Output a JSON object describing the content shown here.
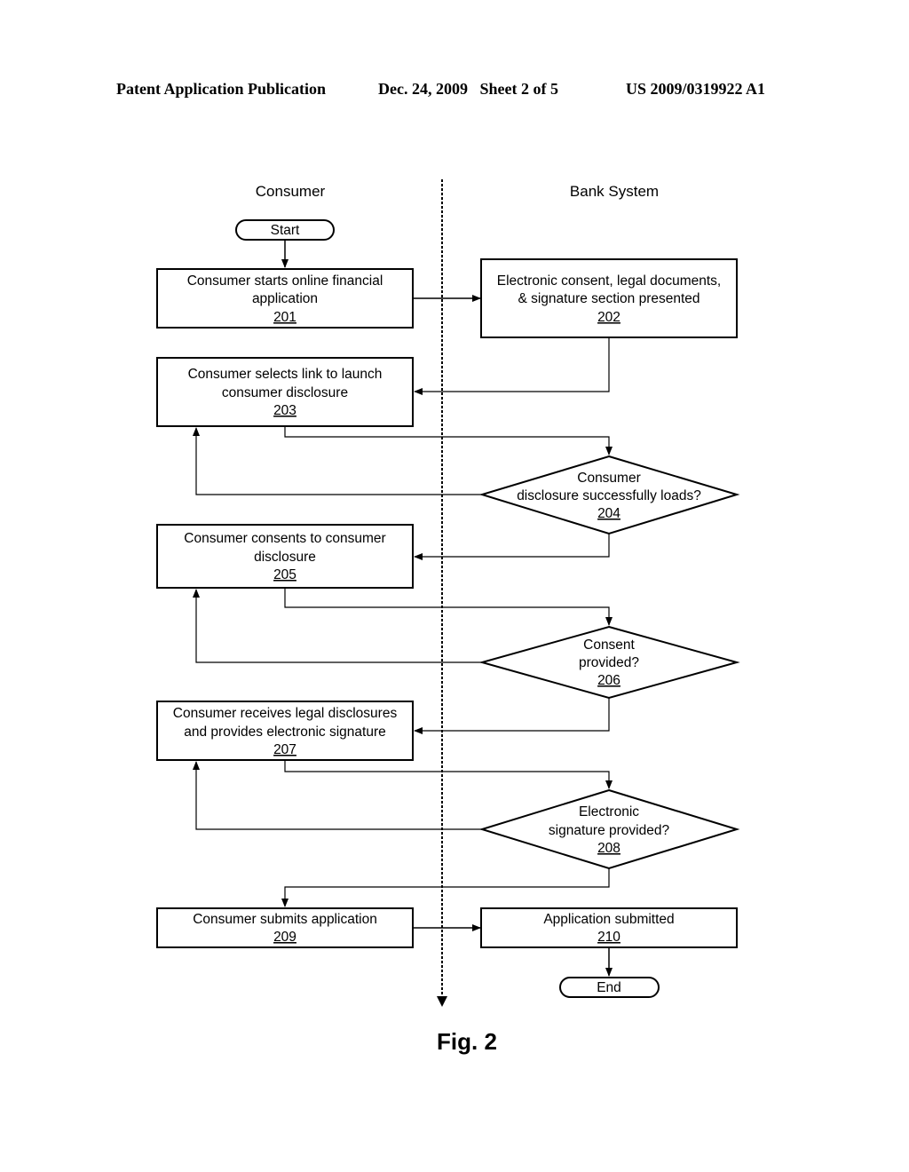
{
  "header": {
    "left": "Patent Application Publication",
    "middle": "Dec. 24, 2009   Sheet 2 of 5",
    "right": "US 2009/0319922 A1"
  },
  "lanes": {
    "consumer": "Consumer",
    "bank": "Bank System"
  },
  "terminals": {
    "start": "Start",
    "end": "End"
  },
  "steps": {
    "s201": {
      "lines": [
        "Consumer starts online financial",
        "application"
      ],
      "ref": "201"
    },
    "s202": {
      "lines": [
        "Electronic consent, legal documents,",
        "& signature section presented"
      ],
      "ref": "202"
    },
    "s203": {
      "lines": [
        "Consumer selects link to launch",
        "consumer disclosure"
      ],
      "ref": "203"
    },
    "s204": {
      "lines": [
        "Consumer",
        "disclosure successfully loads?"
      ],
      "ref": "204"
    },
    "s205": {
      "lines": [
        "Consumer consents to consumer",
        "disclosure"
      ],
      "ref": "205"
    },
    "s206": {
      "lines": [
        "Consent",
        "provided?"
      ],
      "ref": "206"
    },
    "s207": {
      "lines": [
        "Consumer receives legal disclosures",
        "and provides electronic signature"
      ],
      "ref": "207"
    },
    "s208": {
      "lines": [
        "Electronic",
        "signature provided?"
      ],
      "ref": "208"
    },
    "s209": {
      "lines": [
        "Consumer submits application"
      ],
      "ref": "209"
    },
    "s210": {
      "lines": [
        "Application submitted"
      ],
      "ref": "210"
    }
  },
  "figure_label": "Fig. 2"
}
